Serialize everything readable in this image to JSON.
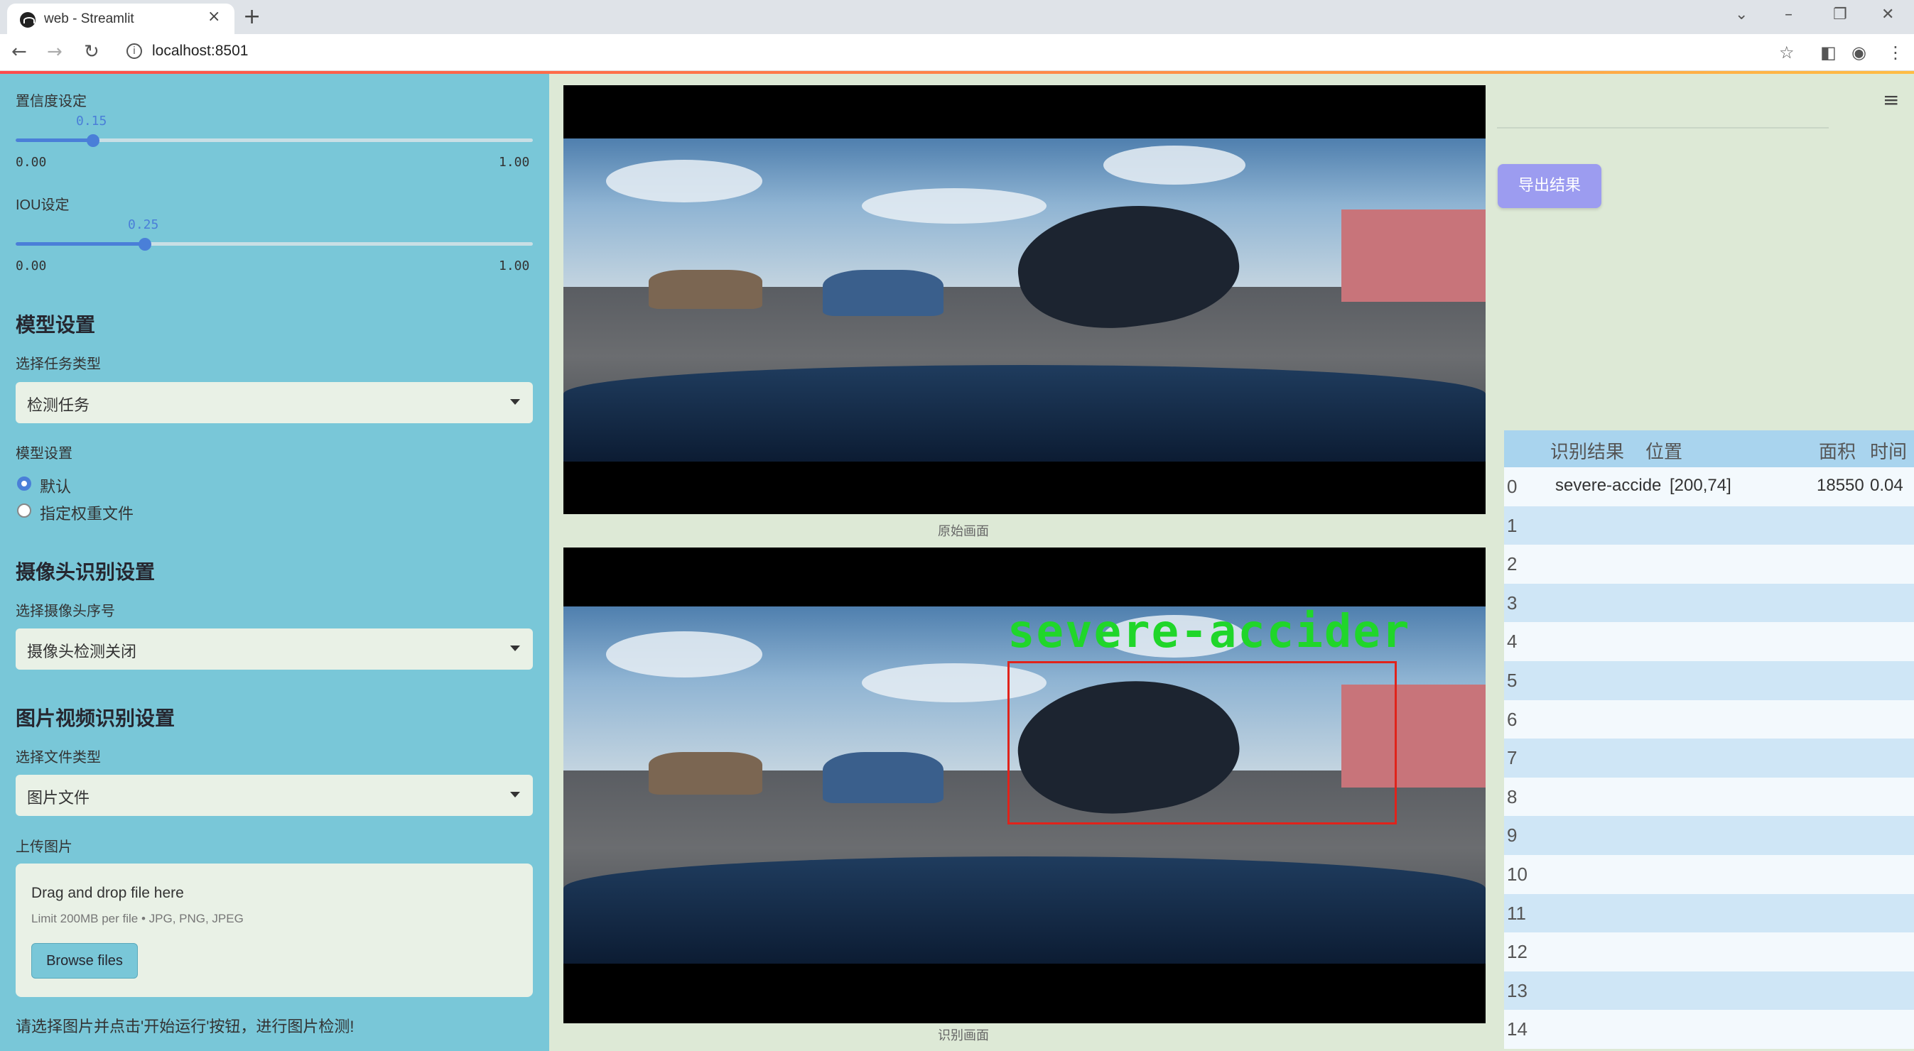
{
  "browser": {
    "tab_title": "web - Streamlit",
    "tab_close": "×",
    "new_tab": "+",
    "url": "localhost:8501"
  },
  "sidebar": {
    "confidence": {
      "label": "置信度设定",
      "value": "0.15",
      "fraction": 0.15,
      "min": "0.00",
      "max": "1.00"
    },
    "iou": {
      "label": "IOU设定",
      "value": "0.25",
      "fraction": 0.25,
      "min": "0.00",
      "max": "1.00"
    },
    "model_section": {
      "title": "模型设置",
      "task_label": "选择任务类型",
      "task_value": "检测任务",
      "model_label": "模型设置",
      "options": [
        "默认",
        "指定权重文件"
      ],
      "selected_option": "默认"
    },
    "camera_section": {
      "title": "摄像头识别设置",
      "label": "选择摄像头序号",
      "value": "摄像头检测关闭"
    },
    "file_section": {
      "title": "图片视频识别设置",
      "type_label": "选择文件类型",
      "type_value": "图片文件",
      "upload_label": "上传图片",
      "drop_text": "Drag and drop file here",
      "limit_text": "Limit 200MB per file • JPG, PNG, JPEG",
      "browse_label": "Browse files"
    },
    "hint": "请选择图片并点击'开始运行'按钮，进行图片检测!"
  },
  "main": {
    "original_caption": "原始画面",
    "result_caption": "识别画面",
    "detection_label": "severe-accider",
    "export_label": "导出结果"
  },
  "table": {
    "headers": [
      "识别结果",
      "位置",
      "面积",
      "时间"
    ],
    "rows": [
      {
        "index": "0",
        "result": "severe-accide",
        "position": "[200,74]",
        "area": "18550",
        "time": "0.04"
      },
      {
        "index": "1"
      },
      {
        "index": "2"
      },
      {
        "index": "3"
      },
      {
        "index": "4"
      },
      {
        "index": "5"
      },
      {
        "index": "6"
      },
      {
        "index": "7"
      },
      {
        "index": "8"
      },
      {
        "index": "9"
      },
      {
        "index": "10"
      },
      {
        "index": "11"
      },
      {
        "index": "12"
      },
      {
        "index": "13"
      },
      {
        "index": "14"
      }
    ]
  }
}
